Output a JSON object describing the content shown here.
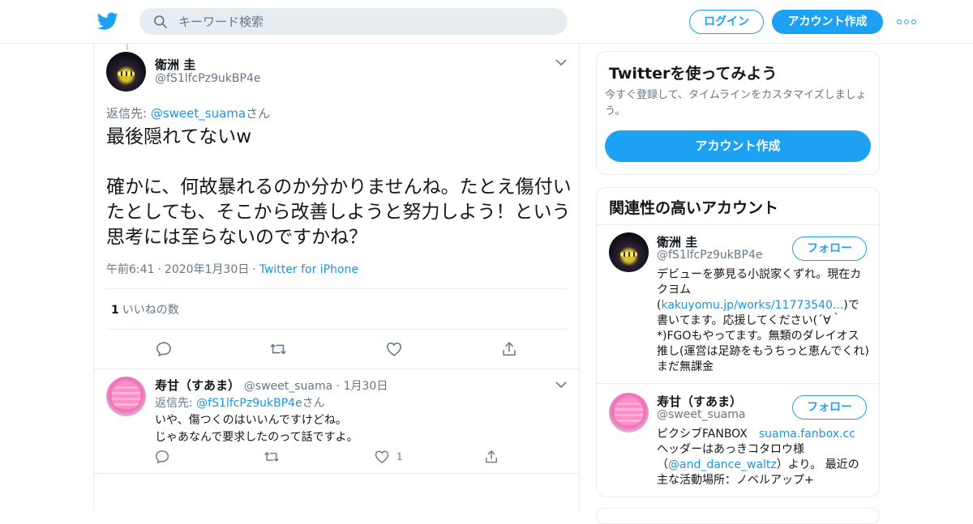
{
  "header": {
    "logo": "twitter-bird-icon",
    "search_placeholder": "キーワード検索",
    "login_label": "ログイン",
    "signup_label": "アカウント作成",
    "brand_color": "#1da1f2"
  },
  "main_tweet": {
    "name": "衛洲 圭",
    "handle": "@fS1lfcPz9ukBP4e",
    "reply_prefix": "返信先: ",
    "reply_to": "@sweet_suama",
    "reply_suffix": "さん",
    "text": "最後隠れてないw\n\n確かに、何故暴れるのか分かりませんね。たとえ傷付いたとしても、そこから改善しようと努力しよう！という思考には至らないのですかね？",
    "time": "午前6:41",
    "date": "2020年1月30日",
    "source": "Twitter for iPhone",
    "like_count": "1",
    "like_label": "いいねの数"
  },
  "reply_tweet": {
    "name": "寿甘（すあま）",
    "handle": "@sweet_suama",
    "date": "1月30日",
    "reply_prefix": "返信先: ",
    "reply_to": "@fS1lfcPz9ukBP4e",
    "reply_suffix": "さん",
    "text": "いや、傷つくのはいいんですけどね。\nじゃあなんで要求したのって話ですよ。",
    "like_count": "1"
  },
  "signup_card": {
    "title": "Twitterを使ってみよう",
    "description": "今すぐ登録して、タイムラインをカスタマイズしましょう。",
    "button": "アカウント作成"
  },
  "related": {
    "title": "関連性の高いアカウント",
    "follow_label": "フォロー",
    "accounts": [
      {
        "name": "衛洲 圭",
        "handle": "@fS1lfcPz9ukBP4e",
        "bio_1": "デビューを夢見る小説家くずれ。現在カクヨム(",
        "bio_link": "kakuyomu.jp/works/11773540...",
        "bio_2": ")で書いてます。応援してください(´∀｀*)FGOもやってます。無類のダレイオス推し(運営は足跡をもうちっと恵んでくれ)まだ無課金"
      },
      {
        "name": "寿甘（すあま）",
        "handle": "@sweet_suama",
        "bio_1": "ピクシブFANBOX　",
        "bio_link": "suama.fanbox.cc",
        "bio_2": " ヘッダーはあっきコタロウ様（",
        "bio_link2": "@and_dance_waltz",
        "bio_3": "）より。 最近の主な活動場所：ノベルアップ+"
      }
    ]
  }
}
